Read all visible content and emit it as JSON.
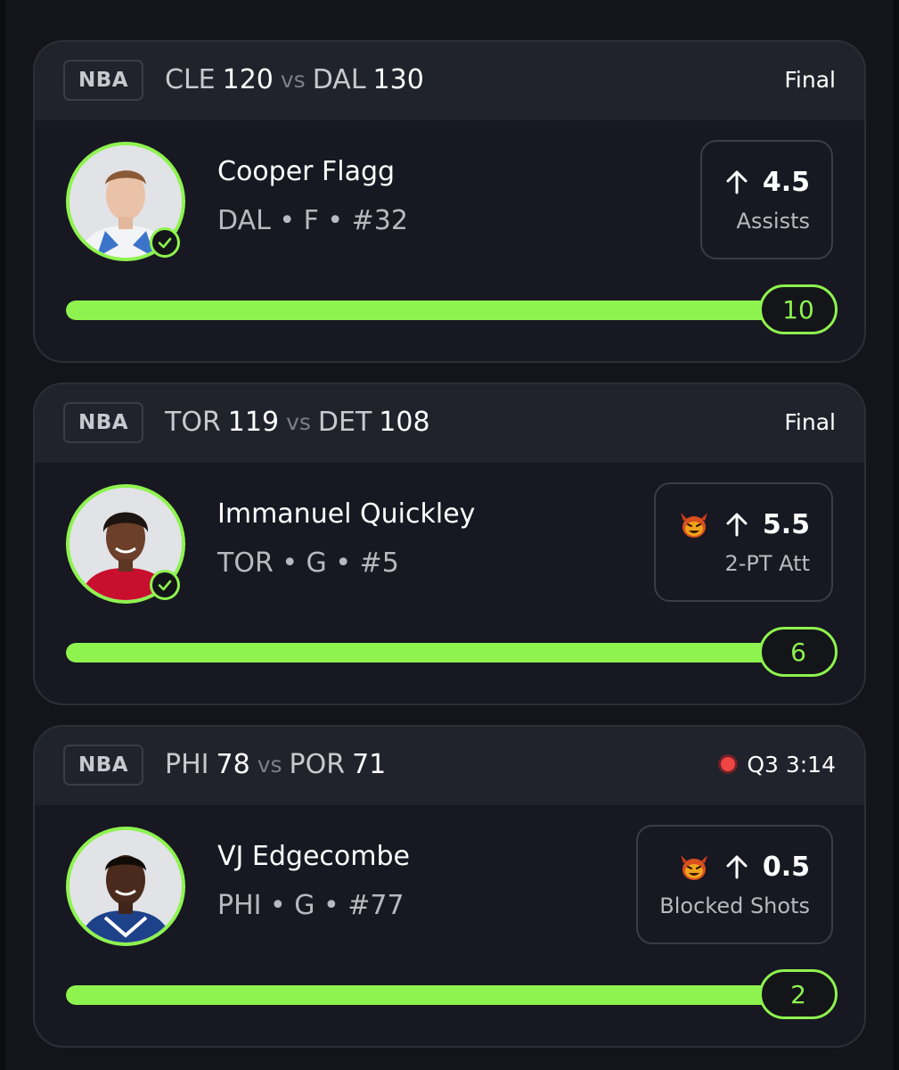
{
  "colors": {
    "accent_green": "#8ef34f",
    "live_red": "#f04545",
    "background": "#14151b"
  },
  "cards": [
    {
      "league": "NBA",
      "team1": "CLE",
      "score1": "120",
      "vs": "vs",
      "team2": "DAL",
      "score2": "130",
      "status": "Final",
      "live": false,
      "player_name": "Cooper Flagg",
      "player_meta": "DAL • F • #32",
      "pick_icon": "arrow-up-icon",
      "has_demon": false,
      "pick_line": "4.5",
      "pick_stat": "Assists",
      "result": "10",
      "progress": 1.0
    },
    {
      "league": "NBA",
      "team1": "TOR",
      "score1": "119",
      "vs": "vs",
      "team2": "DET",
      "score2": "108",
      "status": "Final",
      "live": false,
      "player_name": "Immanuel Quickley",
      "player_meta": "TOR • G • #5",
      "pick_icon": "arrow-up-icon",
      "has_demon": true,
      "pick_line": "5.5",
      "pick_stat": "2-PT Att",
      "result": "6",
      "progress": 1.0
    },
    {
      "league": "NBA",
      "team1": "PHI",
      "score1": "78",
      "vs": "vs",
      "team2": "POR",
      "score2": "71",
      "status": "Q3 3:14",
      "live": true,
      "player_name": "VJ Edgecombe",
      "player_meta": "PHI • G • #77",
      "pick_icon": "arrow-up-icon",
      "has_demon": true,
      "pick_line": "0.5",
      "pick_stat": "Blocked Shots",
      "result": "2",
      "progress": 1.0
    }
  ]
}
